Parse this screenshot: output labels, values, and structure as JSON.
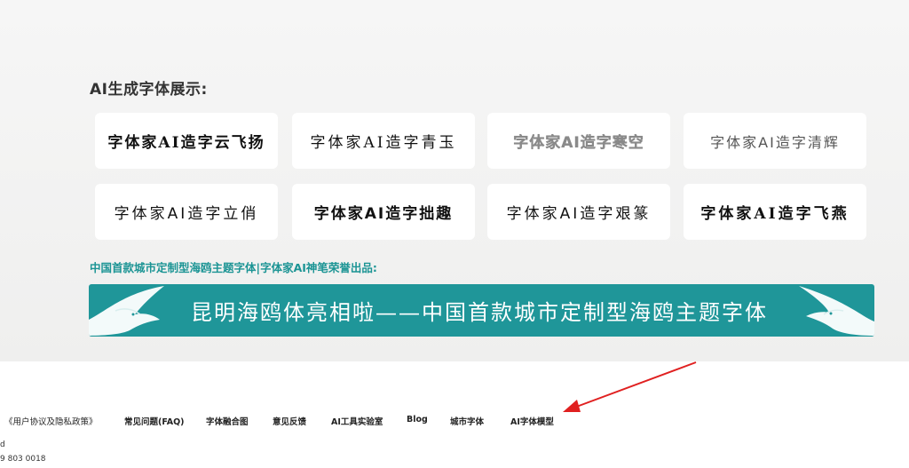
{
  "section": {
    "title": "AI生成字体展示:"
  },
  "font_samples": [
    "字体家AI造字云飞扬",
    "字体家AI造字青玉",
    "字体家AI造字寒空",
    "字体家AI造字清辉",
    "字体家AI造字立俏",
    "字体家AI造字拙趣",
    "字体家AI造字艰篆",
    "字体家AI造字飞燕"
  ],
  "promo": {
    "title": "中国首款城市定制型海鸥主题字体|字体家AI神笔荣誉出品:",
    "banner_text": "昆明海鸥体亮相啦——中国首款城市定制型海鸥主题字体"
  },
  "footer": {
    "links": [
      "《用户协议及隐私政策》",
      "常见问题(FAQ)",
      "字体融合图",
      "意见反馈",
      "AI工具实验室",
      "Blog",
      "城市字体",
      "AI字体模型"
    ],
    "line1": "d",
    "line2": "9 803 0018"
  },
  "colors": {
    "accent_teal": "#1b9494",
    "banner_bg": "#1f9699",
    "annotation_red": "#e02020"
  },
  "icons": {
    "banner_left": "seagull-icon",
    "banner_right": "seagull-icon",
    "annotation": "red-arrow-icon"
  }
}
